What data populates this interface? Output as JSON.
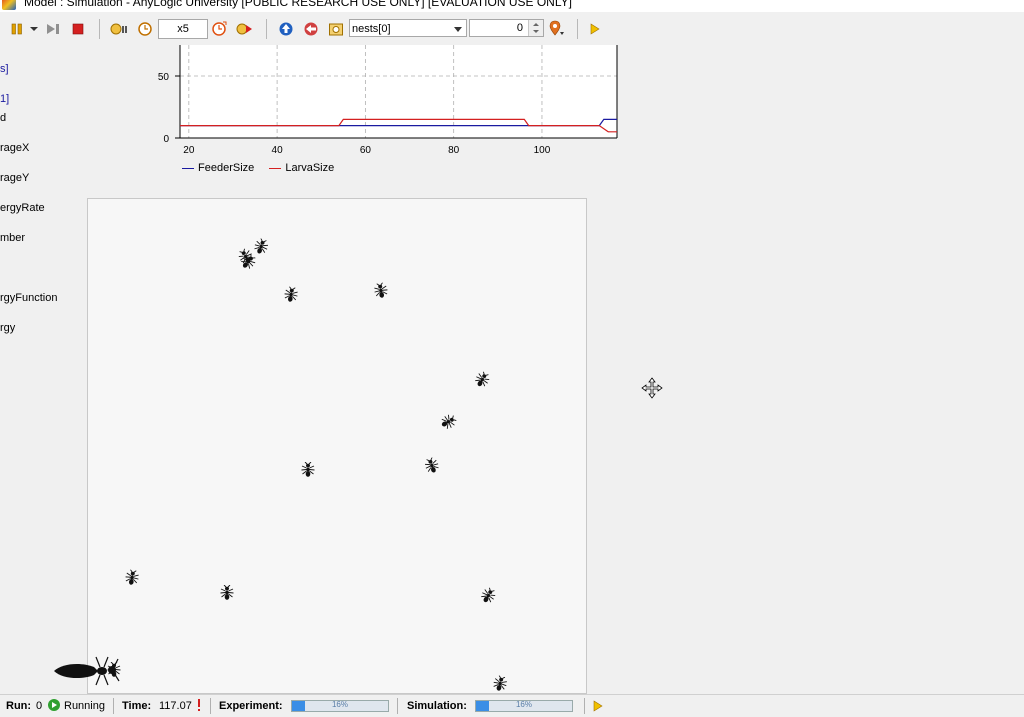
{
  "window": {
    "title": "Model : Simulation - AnyLogic University  [PUBLIC RESEARCH USE ONLY] [EVALUATION USE ONLY]"
  },
  "toolbar": {
    "speed": "x5",
    "agent_select": "nests[0]",
    "agent_index": "0"
  },
  "left_panel": {
    "items": [
      "s]",
      "1]",
      "d",
      "rageX",
      "rageY",
      "ergyRate",
      "mber",
      "rgyFunction",
      "rgy"
    ]
  },
  "chart_data": {
    "type": "line",
    "x_ticks": [
      "20",
      "40",
      "60",
      "80",
      "100"
    ],
    "y_ticks": [
      "0",
      "50"
    ],
    "xlim": [
      18,
      117
    ],
    "ylim": [
      0,
      75
    ],
    "grid": true,
    "legend_position": "bottom-left",
    "series": [
      {
        "name": "FeederSize",
        "color": "#1a1aa0",
        "x": [
          18,
          113,
          114,
          117
        ],
        "y": [
          10,
          10,
          15,
          15
        ]
      },
      {
        "name": "LarvaSize",
        "color": "#d42020",
        "x": [
          18,
          54,
          55,
          96,
          97,
          113,
          115,
          117
        ],
        "y": [
          10,
          10,
          15,
          15,
          10,
          10,
          5,
          5
        ]
      }
    ]
  },
  "status": {
    "run_label": "Run:",
    "run_value": "0",
    "state": "Running",
    "time_label": "Time:",
    "time_value": "117.07",
    "experiment_label": "Experiment:",
    "experiment_progress": 16,
    "experiment_pct_text": "16%",
    "simulation_label": "Simulation:",
    "simulation_progress": 16,
    "simulation_pct_text": "16%"
  }
}
